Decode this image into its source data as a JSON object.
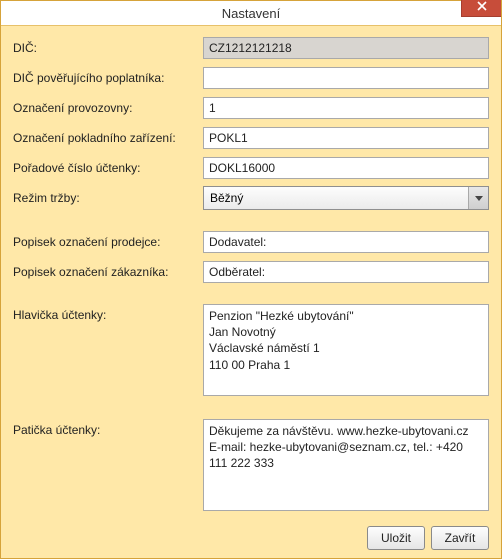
{
  "window": {
    "title": "Nastavení"
  },
  "labels": {
    "dic": "DIČ:",
    "dic_pov": "DIČ pověřujícího poplatníka:",
    "oznaceni_provozovny": "Označení provozovny:",
    "oznaceni_zarizeni": "Označení pokladního zařízení:",
    "poradove_cislo": "Pořadové číslo účtenky:",
    "rezim": "Režim tržby:",
    "popisek_prodejce": "Popisek označení prodejce:",
    "popisek_zakaznik": "Popisek označení zákazníka:",
    "hlavicka": "Hlavička účtenky:",
    "paticka": "Patička účtenky:"
  },
  "fields": {
    "dic": "CZ1212121218",
    "dic_pov": "",
    "oznaceni_provozovny": "1",
    "oznaceni_zarizeni": "POKL1",
    "poradove_cislo": "DOKL16000",
    "rezim": "Běžný",
    "popisek_prodejce": "Dodavatel:",
    "popisek_zakaznik": "Odběratel:",
    "hlavicka": "Penzion \"Hezké ubytování\"\nJan Novotný\nVáclavské náměstí 1\n110 00 Praha 1",
    "paticka": "Děkujeme za návštěvu. www.hezke-ubytovani.cz\nE-mail: hezke-ubytovani@seznam.cz, tel.: +420 111 222 333"
  },
  "buttons": {
    "save": "Uložit",
    "close": "Zavřít"
  },
  "icons": {
    "close": "close-icon",
    "dropdown": "chevron-down-icon"
  }
}
